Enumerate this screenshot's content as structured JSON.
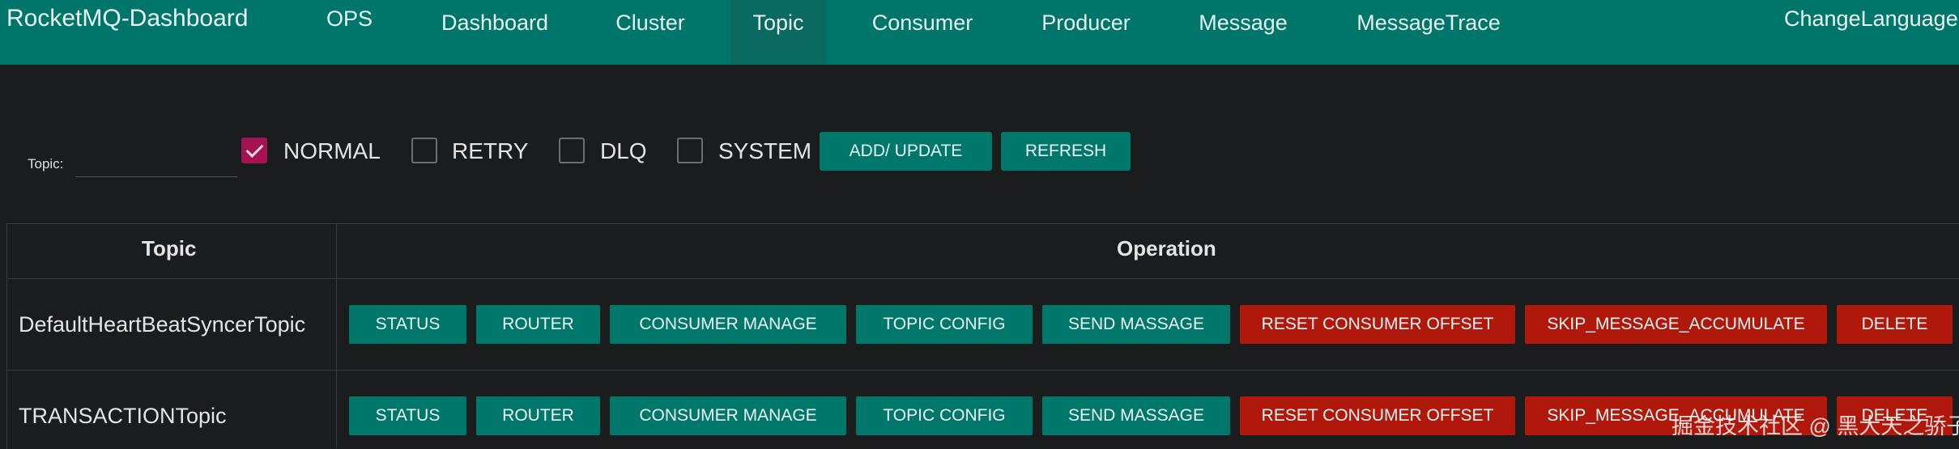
{
  "navbar": {
    "brand": "RocketMQ-Dashboard",
    "ops": "OPS",
    "items": [
      "Dashboard",
      "Cluster",
      "Topic",
      "Consumer",
      "Producer",
      "Message",
      "MessageTrace"
    ],
    "active": "Topic",
    "change_language": "ChangeLanguage"
  },
  "filter": {
    "topic_label": "Topic:",
    "topic_value": "",
    "checkboxes": [
      {
        "label": "NORMAL",
        "checked": true
      },
      {
        "label": "RETRY",
        "checked": false
      },
      {
        "label": "DLQ",
        "checked": false
      },
      {
        "label": "SYSTEM",
        "checked": false
      }
    ],
    "add_update": "ADD/ UPDATE",
    "refresh": "REFRESH"
  },
  "table": {
    "headers": [
      "Topic",
      "Operation"
    ],
    "operations": [
      "STATUS",
      "ROUTER",
      "CONSUMER MANAGE",
      "TOPIC CONFIG",
      "SEND MASSAGE",
      "RESET CONSUMER OFFSET",
      "SKIP_MESSAGE_ACCUMULATE",
      "DELETE"
    ],
    "rows": [
      {
        "topic": "DefaultHeartBeatSyncerTopic"
      },
      {
        "topic": "TRANSACTIONTopic"
      }
    ]
  },
  "watermark": "掘金技术社区 @ 黑大天之骄子",
  "colors": {
    "primary": "#00766a",
    "danger": "#b0180c",
    "checkbox": "#a3134f",
    "background": "#1b1c1e"
  }
}
